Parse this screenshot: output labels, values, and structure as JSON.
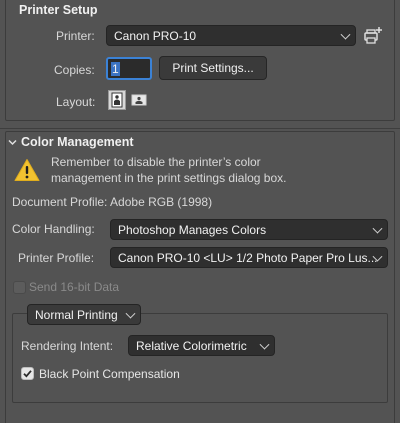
{
  "printer_setup": {
    "title": "Printer Setup",
    "printer_label": "Printer:",
    "printer_value": "Canon PRO-10",
    "copies_label": "Copies:",
    "copies_value": "1",
    "print_settings_button": "Print Settings...",
    "layout_label": "Layout:"
  },
  "color_management": {
    "title": "Color Management",
    "warning_line1": "Remember to disable the printer’s color",
    "warning_line2": "management in the print settings dialog box.",
    "document_profile": "Document Profile: Adobe RGB (1998)",
    "color_handling_label": "Color Handling:",
    "color_handling_value": "Photoshop Manages Colors",
    "printer_profile_label": "Printer Profile:",
    "printer_profile_value": "Canon PRO-10 <LU> 1/2 Photo Paper Pro Lus...",
    "send_16bit_label": "Send 16-bit Data",
    "send_16bit_checked": false,
    "print_mode_value": "Normal Printing",
    "rendering_intent_label": "Rendering Intent:",
    "rendering_intent_value": "Relative Colorimetric",
    "black_point_label": "Black Point Compensation",
    "black_point_checked": true
  },
  "icons": {
    "add_printer": "printer-add-icon",
    "portrait": "portrait-orientation-icon",
    "landscape": "landscape-orientation-icon",
    "warning": "warning-triangle-icon",
    "collapse": "chevron-down-icon"
  },
  "colors": {
    "panel_bg": "#535353",
    "field_bg": "#2f2f2f",
    "focus_ring": "#3b82d6",
    "warning_yellow": "#f2c230"
  }
}
